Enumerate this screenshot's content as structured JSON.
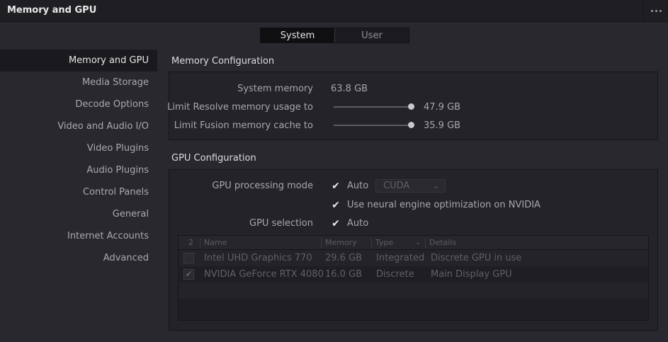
{
  "window": {
    "title": "Memory and GPU"
  },
  "tabs": [
    {
      "label": "System",
      "active": true
    },
    {
      "label": "User",
      "active": false
    }
  ],
  "sidebar": {
    "items": [
      {
        "label": "Memory and GPU",
        "active": true
      },
      {
        "label": "Media Storage"
      },
      {
        "label": "Decode Options"
      },
      {
        "label": "Video and Audio I/O"
      },
      {
        "label": "Video Plugins"
      },
      {
        "label": "Audio Plugins"
      },
      {
        "label": "Control Panels"
      },
      {
        "label": "General"
      },
      {
        "label": "Internet Accounts"
      },
      {
        "label": "Advanced"
      }
    ]
  },
  "memory": {
    "section_title": "Memory Configuration",
    "system_memory_label": "System memory",
    "system_memory_value": "63.8 GB",
    "resolve_limit_label": "Limit Resolve memory usage to",
    "resolve_limit_value": "47.9 GB",
    "resolve_limit_fraction": 1.0,
    "fusion_limit_label": "Limit Fusion memory cache to",
    "fusion_limit_value": "35.9 GB",
    "fusion_limit_fraction": 1.0
  },
  "gpu": {
    "section_title": "GPU Configuration",
    "processing_mode_label": "GPU processing mode",
    "processing_mode_auto_label": "Auto",
    "processing_mode_auto_checked": true,
    "processing_mode_dropdown": "CUDA",
    "neural_engine_label": "Use neural engine optimization on NVIDIA",
    "neural_engine_checked": true,
    "selection_label": "GPU selection",
    "selection_auto_label": "Auto",
    "selection_auto_checked": true,
    "table": {
      "count_header": "2",
      "columns": [
        "Name",
        "Memory",
        "Type",
        "Details"
      ],
      "rows": [
        {
          "checked": false,
          "name": "Intel UHD Graphics 770",
          "memory": "29.6 GB",
          "type": "Integrated",
          "details": "Discrete GPU in use"
        },
        {
          "checked": true,
          "name": "NVIDIA GeForce RTX 4080",
          "memory": "16.0 GB",
          "type": "Discrete",
          "details": "Main Display GPU"
        }
      ]
    }
  }
}
